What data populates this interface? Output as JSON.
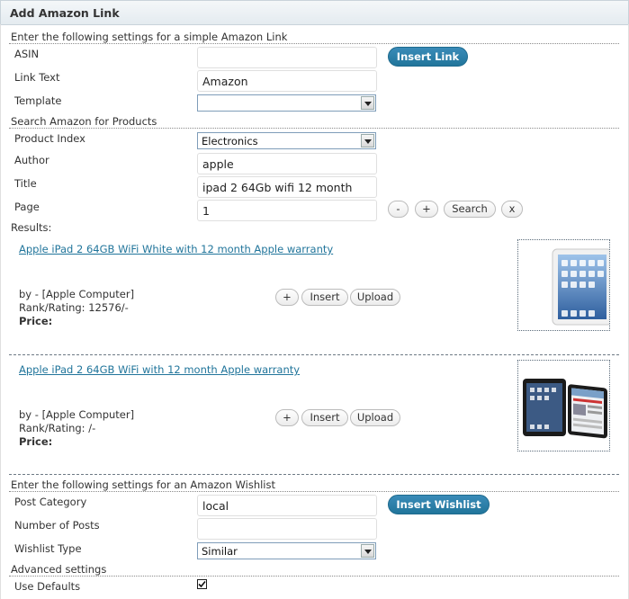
{
  "header": {
    "title": "Add Amazon Link"
  },
  "simple": {
    "heading": "Enter the following settings for a simple Amazon Link",
    "asin_label": "ASIN",
    "asin_value": "",
    "link_text_label": "Link Text",
    "link_text_value": "Amazon",
    "template_label": "Template",
    "template_value": "",
    "insert_link_button": "Insert Link"
  },
  "search": {
    "heading": "Search Amazon for Products",
    "product_index_label": "Product Index",
    "product_index_value": "Electronics",
    "author_label": "Author",
    "author_value": "apple",
    "title_label": "Title",
    "title_value": "ipad 2 64Gb wifi 12 month",
    "page_label": "Page",
    "page_value": "1",
    "minus_button": "-",
    "plus_button": "+",
    "search_button": "Search",
    "clear_button": "x",
    "results_label": "Results:"
  },
  "results": [
    {
      "title": "Apple iPad 2 64GB WiFi White with 12 month Apple warranty",
      "by": "by - [Apple Computer]",
      "rank": "Rank/Rating: 12576/-",
      "price_label": "Price:",
      "add_button": "+",
      "insert_button": "Insert",
      "upload_button": "Upload",
      "image_icon": "ipad-white-product-image"
    },
    {
      "title": "Apple iPad 2 64GB WiFi with 12 month Apple warranty",
      "by": "by - [Apple Computer]",
      "rank": "Rank/Rating: /-",
      "price_label": "Price:",
      "add_button": "+",
      "insert_button": "Insert",
      "upload_button": "Upload",
      "image_icon": "ipad-black-product-image"
    }
  ],
  "wishlist": {
    "heading": "Enter the following settings for an Amazon Wishlist",
    "post_category_label": "Post Category",
    "post_category_value": "local",
    "number_of_posts_label": "Number of Posts",
    "number_of_posts_value": "",
    "wishlist_type_label": "Wishlist Type",
    "wishlist_type_value": "Similar",
    "insert_wishlist_button": "Insert Wishlist"
  },
  "advanced": {
    "heading": "Advanced settings",
    "use_defaults_label": "Use Defaults",
    "use_defaults_checked": true
  }
}
